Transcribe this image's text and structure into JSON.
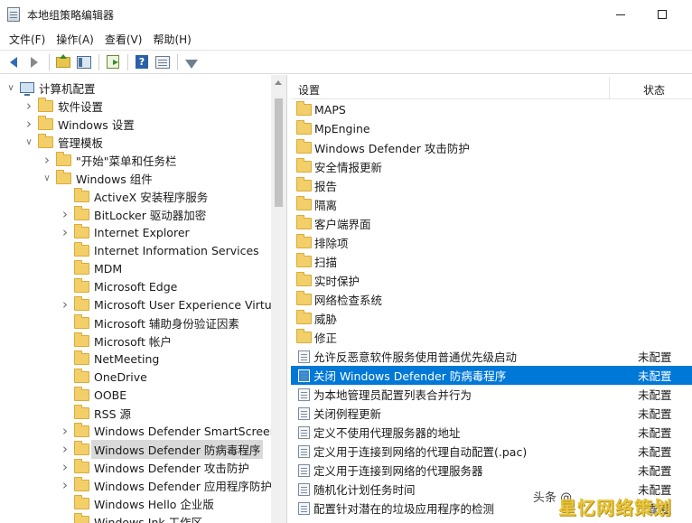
{
  "window": {
    "title": "本地组策略编辑器"
  },
  "menu": [
    "文件(F)",
    "操作(A)",
    "查看(V)",
    "帮助(H)"
  ],
  "toolbar": [
    "back-icon",
    "forward-icon",
    "up-folder-icon",
    "show-hide-tree-icon",
    "export-list-icon",
    "help-icon",
    "view-icon",
    "filter-icon"
  ],
  "tree": [
    {
      "label": "计算机配置",
      "level": 0,
      "expand": "open",
      "icon": "computer-icon"
    },
    {
      "label": "软件设置",
      "level": 1,
      "expand": "closed",
      "icon": "folder-icon"
    },
    {
      "label": "Windows 设置",
      "level": 1,
      "expand": "closed",
      "icon": "folder-icon"
    },
    {
      "label": "管理模板",
      "level": 1,
      "expand": "open",
      "icon": "folder-icon"
    },
    {
      "label": "\"开始\"菜单和任务栏",
      "level": 2,
      "expand": "closed",
      "icon": "folder-icon"
    },
    {
      "label": "Windows 组件",
      "level": 2,
      "expand": "open",
      "icon": "folder-icon"
    },
    {
      "label": "ActiveX 安装程序服务",
      "level": 3,
      "expand": "none",
      "icon": "folder-icon"
    },
    {
      "label": "BitLocker 驱动器加密",
      "level": 3,
      "expand": "closed",
      "icon": "folder-icon"
    },
    {
      "label": "Internet Explorer",
      "level": 3,
      "expand": "closed",
      "icon": "folder-icon"
    },
    {
      "label": "Internet Information Services",
      "level": 3,
      "expand": "none",
      "icon": "folder-icon"
    },
    {
      "label": "MDM",
      "level": 3,
      "expand": "none",
      "icon": "folder-icon"
    },
    {
      "label": "Microsoft Edge",
      "level": 3,
      "expand": "none",
      "icon": "folder-icon"
    },
    {
      "label": "Microsoft User Experience Virtuali",
      "level": 3,
      "expand": "closed",
      "icon": "folder-icon"
    },
    {
      "label": "Microsoft 辅助身份验证因素",
      "level": 3,
      "expand": "none",
      "icon": "folder-icon"
    },
    {
      "label": "Microsoft 帐户",
      "level": 3,
      "expand": "none",
      "icon": "folder-icon"
    },
    {
      "label": "NetMeeting",
      "level": 3,
      "expand": "none",
      "icon": "folder-icon"
    },
    {
      "label": "OneDrive",
      "level": 3,
      "expand": "none",
      "icon": "folder-icon"
    },
    {
      "label": "OOBE",
      "level": 3,
      "expand": "none",
      "icon": "folder-icon"
    },
    {
      "label": "RSS 源",
      "level": 3,
      "expand": "none",
      "icon": "folder-icon"
    },
    {
      "label": "Windows Defender SmartScreen",
      "level": 3,
      "expand": "closed",
      "icon": "folder-icon"
    },
    {
      "label": "Windows Defender 防病毒程序",
      "level": 3,
      "expand": "closed",
      "icon": "folder-icon",
      "selected": true
    },
    {
      "label": "Windows Defender 攻击防护",
      "level": 3,
      "expand": "closed",
      "icon": "folder-icon"
    },
    {
      "label": "Windows Defender 应用程序防护",
      "level": 3,
      "expand": "closed",
      "icon": "folder-icon"
    },
    {
      "label": "Windows Hello 企业版",
      "level": 3,
      "expand": "none",
      "icon": "folder-icon"
    },
    {
      "label": "Windows Ink 工作区",
      "level": 3,
      "expand": "none",
      "icon": "folder-icon"
    }
  ],
  "list": {
    "headers": {
      "setting": "设置",
      "state": "状态"
    },
    "folders": [
      "MAPS",
      "MpEngine",
      "Windows Defender 攻击防护",
      "安全情报更新",
      "报告",
      "隔离",
      "客户端界面",
      "排除项",
      "扫描",
      "实时保护",
      "网络检查系统",
      "威胁",
      "修正"
    ],
    "policies": [
      {
        "name": "允许反恶意软件服务使用普通优先级启动",
        "state": "未配置"
      },
      {
        "name": "关闭 Windows Defender 防病毒程序",
        "state": "未配置",
        "selected": true
      },
      {
        "name": "为本地管理员配置列表合并行为",
        "state": "未配置"
      },
      {
        "name": "关闭例程更新",
        "state": "未配置"
      },
      {
        "name": "定义不使用代理服务器的地址",
        "state": "未配置"
      },
      {
        "name": "定义用于连接到网络的代理自动配置(.pac)",
        "state": "未配置"
      },
      {
        "name": "定义用于连接到网络的代理服务器",
        "state": "未配置"
      },
      {
        "name": "随机化计划任务时间",
        "state": "未配置"
      },
      {
        "name": "配置针对潜在的垃圾应用程序的检测",
        "state": "未配置"
      }
    ]
  },
  "watermark": {
    "source": "头条 @",
    "brand": "星忆网络策划"
  },
  "colors": {
    "selection": "#0078d7",
    "folder": "#f3cf6a",
    "watermark": "#e8c53a"
  }
}
